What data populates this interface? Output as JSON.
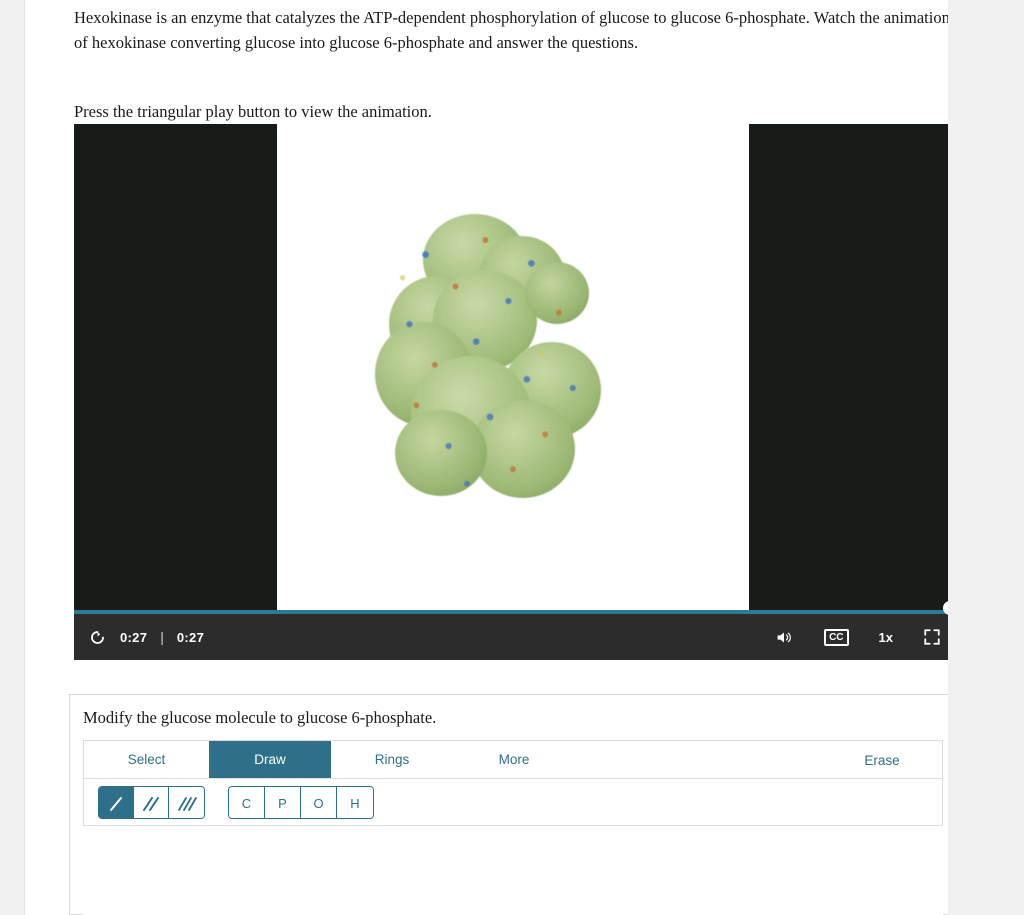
{
  "passage": {
    "paragraph": "Hexokinase is an enzyme that catalyzes the ATP-dependent phosphorylation of glucose to glucose 6-phosphate. Watch the animation of hexokinase converting glucose into glucose 6-phosphate and answer the questions.",
    "instruction": "Press the triangular play button to view the animation."
  },
  "video": {
    "current_time": "0:27",
    "total_time": "0:27",
    "time_separator": "|",
    "replay_icon": "replay-icon",
    "volume_icon": "volume-icon",
    "captions_label": "CC",
    "speed_label": "1x",
    "fullscreen_icon": "fullscreen-icon",
    "progress_percent": 100,
    "accent_color": "#2e7a95",
    "bar_color": "#2c2c2c",
    "stage_color": "#171c18"
  },
  "editor": {
    "prompt": "Modify the glucose molecule to glucose 6-phosphate.",
    "accent_color": "#2e7089",
    "tabs": [
      {
        "label": "Select",
        "active": false
      },
      {
        "label": "Draw",
        "active": true
      },
      {
        "label": "Rings",
        "active": false
      },
      {
        "label": "More",
        "active": false
      }
    ],
    "erase_label": "Erase",
    "bond_tools": [
      {
        "name": "single-bond",
        "active": true
      },
      {
        "name": "double-bond",
        "active": false
      },
      {
        "name": "triple-bond",
        "active": false
      }
    ],
    "atom_tools": [
      {
        "label": "C"
      },
      {
        "label": "P"
      },
      {
        "label": "O"
      },
      {
        "label": "H"
      }
    ]
  },
  "scrollbar": {
    "thumb_color": "#c6c6c6"
  }
}
